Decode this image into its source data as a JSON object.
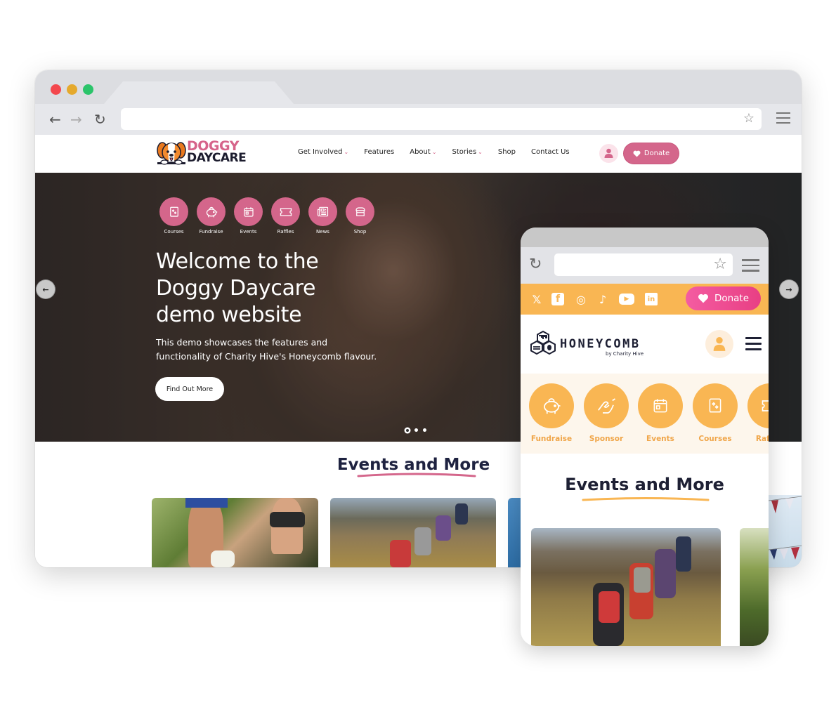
{
  "desktop": {
    "browser": {
      "window_controls": [
        "close",
        "minimize",
        "maximize"
      ],
      "icons": {
        "back": "arrow-left-icon",
        "forward": "arrow-right-icon",
        "reload": "reload-icon",
        "bookmark": "star-icon",
        "menu": "hamburger-menu-icon"
      },
      "back_glyph": "←",
      "forward_glyph": "→",
      "reload_glyph": "↻",
      "star_glyph": "☆",
      "url": ""
    },
    "header": {
      "logo": {
        "line1": "DOGGY",
        "line2": "DAYCARE"
      },
      "nav": [
        {
          "label": "Get Involved",
          "dropdown": true
        },
        {
          "label": "Features",
          "dropdown": false
        },
        {
          "label": "About",
          "dropdown": true
        },
        {
          "label": "Stories",
          "dropdown": true
        },
        {
          "label": "Shop",
          "dropdown": false
        },
        {
          "label": "Contact Us",
          "dropdown": false
        }
      ],
      "chevron_glyph": "⌄",
      "donate_label": "Donate",
      "accent_color": "#d4668b"
    },
    "hero": {
      "quick_links": [
        {
          "label": "Courses",
          "icon": "book-icon"
        },
        {
          "label": "Fundraise",
          "icon": "piggy-bank-icon"
        },
        {
          "label": "Events",
          "icon": "calendar-icon"
        },
        {
          "label": "Raffles",
          "icon": "ticket-icon"
        },
        {
          "label": "News",
          "icon": "newspaper-icon"
        },
        {
          "label": "Shop",
          "icon": "storefront-icon"
        }
      ],
      "title": "Welcome to the Doggy Daycare demo website",
      "subtitle": "This demo showcases the features and functionality of Charity Hive's Honeycomb flavour.",
      "cta_label": "Find Out More",
      "slides_total": 3,
      "active_slide": 1,
      "prev_glyph": "←",
      "next_glyph": "→"
    },
    "events": {
      "title": "Events and More"
    }
  },
  "mobile": {
    "browser": {
      "reload_glyph": "↻",
      "star_glyph": "☆",
      "url": ""
    },
    "social": [
      {
        "name": "x",
        "glyph": "𝕏",
        "icon": "x-twitter-icon"
      },
      {
        "name": "facebook",
        "glyph": "f",
        "icon": "facebook-icon"
      },
      {
        "name": "instagram",
        "glyph": "◎",
        "icon": "instagram-icon"
      },
      {
        "name": "tiktok",
        "glyph": "♪",
        "icon": "tiktok-icon"
      },
      {
        "name": "youtube",
        "glyph": "▶",
        "icon": "youtube-icon"
      },
      {
        "name": "linkedin",
        "glyph": "in",
        "icon": "linkedin-icon"
      }
    ],
    "donate_label": "Donate",
    "logo": {
      "name": "HONEYCOMB",
      "tagline": "by Charity Hive"
    },
    "quick_links": [
      {
        "label": "Fundraise",
        "icon": "piggy-bank-icon"
      },
      {
        "label": "Sponsor",
        "icon": "handshake-icon"
      },
      {
        "label": "Events",
        "icon": "calendar-icon"
      },
      {
        "label": "Courses",
        "icon": "book-icon"
      },
      {
        "label": "Raffles",
        "icon": "ticket-icon"
      }
    ],
    "events": {
      "title": "Events and More"
    },
    "accent_color": "#f9b653",
    "donate_color": "#ef4c8f"
  }
}
